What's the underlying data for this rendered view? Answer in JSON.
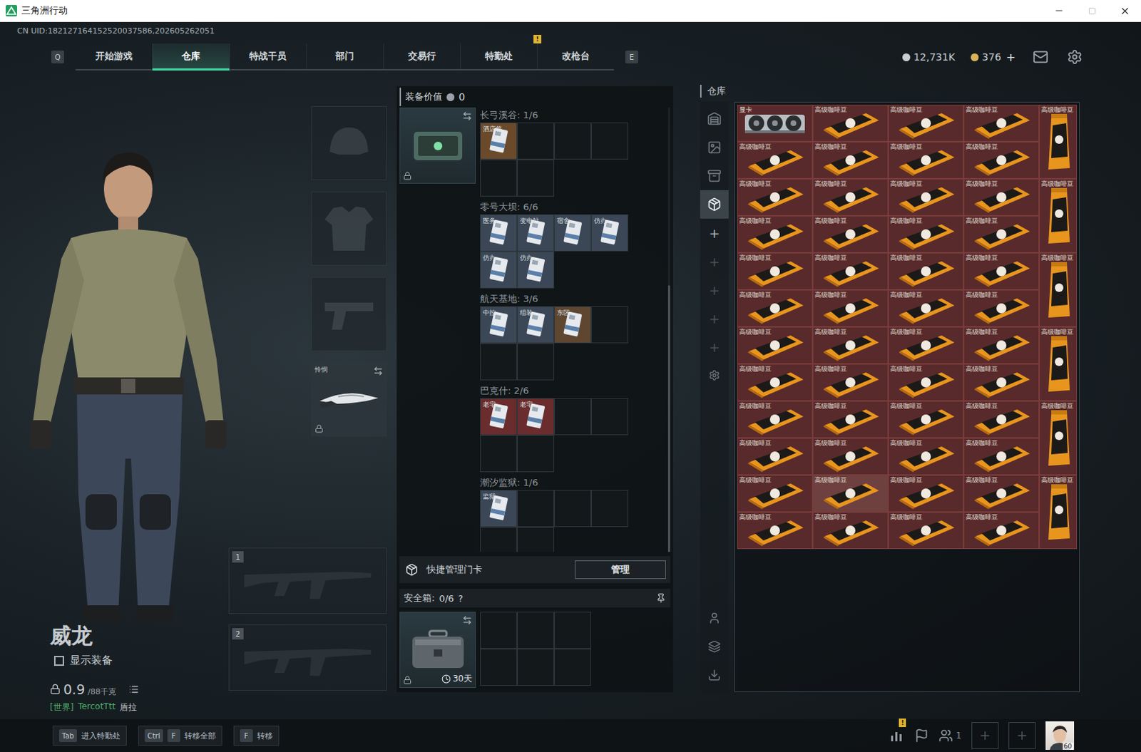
{
  "window": {
    "title": "三角洲行动"
  },
  "uid": "CN UID:182127164152520037586,202605262051",
  "nav": {
    "left_key": "Q",
    "right_key": "E",
    "tabs": [
      {
        "label": "开始游戏",
        "selected": false,
        "alert": ""
      },
      {
        "label": "仓库",
        "selected": true,
        "alert": ""
      },
      {
        "label": "特战干员",
        "selected": false,
        "alert": ""
      },
      {
        "label": "部门",
        "selected": false,
        "alert": ""
      },
      {
        "label": "交易行",
        "selected": false,
        "alert": ""
      },
      {
        "label": "特勤处",
        "selected": false,
        "alert": "!"
      },
      {
        "label": "改枪台",
        "selected": false,
        "alert": ""
      }
    ]
  },
  "currency": [
    {
      "value": "12,731K",
      "add": "",
      "color": "#c9ced3"
    },
    {
      "value": "376",
      "add": "+",
      "color": "#d8b25a"
    }
  ],
  "character": {
    "name": "威龙",
    "show_gear": {
      "label": "显示装备",
      "checked": false
    },
    "weight": {
      "value": "0.9",
      "max": "/88千克"
    },
    "chat": {
      "channel": "[世界]",
      "user": "TercotTtt",
      "message": "盾拉"
    }
  },
  "gear_slots": [
    {
      "kind": "helmet",
      "filled": false,
      "label": "",
      "locked": false
    },
    {
      "kind": "armor",
      "filled": false,
      "label": "",
      "locked": false
    },
    {
      "kind": "pistol",
      "filled": false,
      "label": "",
      "locked": false
    },
    {
      "kind": "melee",
      "filled": true,
      "label": "怜悯",
      "locked": true
    }
  ],
  "weapon_slots": [
    {
      "number": "1",
      "filled": false
    },
    {
      "number": "2",
      "filled": false
    }
  ],
  "loadout": {
    "title": "装备价值",
    "value": "0"
  },
  "keycards": {
    "case_locked": true,
    "slots_per_section": 6,
    "sections": [
      {
        "name": "长弓溪谷",
        "count": "1/6",
        "cards": [
          {
            "label": "酒店将",
            "color": "#6b4a2c"
          }
        ]
      },
      {
        "name": "零号大坝",
        "count": "6/6",
        "cards": [
          {
            "label": "医务",
            "color": "#3b4756"
          },
          {
            "label": "变电站",
            "color": "#3b4756"
          },
          {
            "label": "宿舍",
            "color": "#3b4756"
          },
          {
            "label": "仿办",
            "color": "#3b4756"
          },
          {
            "label": "仿办",
            "color": "#3b4756"
          },
          {
            "label": "仿办",
            "color": "#3b4756"
          }
        ]
      },
      {
        "name": "航天基地",
        "count": "3/6",
        "cards": [
          {
            "label": "中控",
            "color": "#3b4756"
          },
          {
            "label": "组装",
            "color": "#3b4756"
          },
          {
            "label": "东区",
            "color": "#5e4630"
          }
        ]
      },
      {
        "name": "巴克什",
        "count": "2/6",
        "cards": [
          {
            "label": "老宅",
            "color": "#6a2c2c"
          },
          {
            "label": "老宅",
            "color": "#6a2c2c"
          }
        ]
      },
      {
        "name": "潮汐监狱",
        "count": "1/6",
        "cards": [
          {
            "label": "监狱",
            "color": "#3b4756"
          }
        ]
      }
    ]
  },
  "quick_manage": {
    "label": "快捷管理门卡",
    "button": "管理"
  },
  "safe_box": {
    "label": "安全箱:",
    "count": "0/6",
    "help": "?",
    "duration": "30天",
    "slots": 6,
    "locked": true
  },
  "warehouse": {
    "title": "仓库",
    "sidebar_tabs": [
      {
        "selected": false
      },
      {
        "selected": false
      },
      {
        "selected": false
      },
      {
        "selected": true
      }
    ],
    "add_buttons": [
      "+",
      "+",
      "+",
      "+",
      "+"
    ],
    "items": [
      {
        "kind": "gpu",
        "label": "显卡",
        "hovered": false
      },
      {
        "kind": "wide",
        "label": "高级咖啡豆",
        "hovered": false
      },
      {
        "kind": "wide",
        "label": "高级咖啡豆",
        "hovered": false
      },
      {
        "kind": "wide",
        "label": "高级咖啡豆",
        "hovered": false
      },
      {
        "kind": "tall",
        "label": "高级咖啡豆",
        "hovered": false
      },
      {
        "kind": "wide",
        "label": "高级咖啡豆",
        "hovered": false
      },
      {
        "kind": "wide",
        "label": "高级咖啡豆",
        "hovered": false
      },
      {
        "kind": "wide",
        "label": "高级咖啡豆",
        "hovered": false
      },
      {
        "kind": "wide",
        "label": "高级咖啡豆",
        "hovered": false
      },
      {
        "kind": "wide",
        "label": "高级咖啡豆",
        "hovered": false
      },
      {
        "kind": "wide",
        "label": "高级咖啡豆",
        "hovered": false
      },
      {
        "kind": "wide",
        "label": "高级咖啡豆",
        "hovered": false
      },
      {
        "kind": "wide",
        "label": "高级咖啡豆",
        "hovered": false
      },
      {
        "kind": "tall",
        "label": "高级咖啡豆",
        "hovered": false
      },
      {
        "kind": "wide",
        "label": "高级咖啡豆",
        "hovered": false
      },
      {
        "kind": "wide",
        "label": "高级咖啡豆",
        "hovered": false
      },
      {
        "kind": "wide",
        "label": "高级咖啡豆",
        "hovered": false
      },
      {
        "kind": "wide",
        "label": "高级咖啡豆",
        "hovered": false
      },
      {
        "kind": "wide",
        "label": "高级咖啡豆",
        "hovered": false
      },
      {
        "kind": "wide",
        "label": "高级咖啡豆",
        "hovered": false
      },
      {
        "kind": "wide",
        "label": "高级咖啡豆",
        "hovered": false
      },
      {
        "kind": "wide",
        "label": "高级咖啡豆",
        "hovered": false
      },
      {
        "kind": "tall",
        "label": "高级咖啡豆",
        "hovered": false
      },
      {
        "kind": "wide",
        "label": "高级咖啡豆",
        "hovered": false
      },
      {
        "kind": "wide",
        "label": "高级咖啡豆",
        "hovered": false
      },
      {
        "kind": "wide",
        "label": "高级咖啡豆",
        "hovered": false
      },
      {
        "kind": "wide",
        "label": "高级咖啡豆",
        "hovered": false
      },
      {
        "kind": "wide",
        "label": "高级咖啡豆",
        "hovered": false
      },
      {
        "kind": "wide",
        "label": "高级咖啡豆",
        "hovered": false
      },
      {
        "kind": "wide",
        "label": "高级咖啡豆",
        "hovered": false
      },
      {
        "kind": "wide",
        "label": "高级咖啡豆",
        "hovered": false
      },
      {
        "kind": "tall",
        "label": "高级咖啡豆",
        "hovered": false
      },
      {
        "kind": "wide",
        "label": "高级咖啡豆",
        "hovered": false
      },
      {
        "kind": "wide",
        "label": "高级咖啡豆",
        "hovered": false
      },
      {
        "kind": "wide",
        "label": "高级咖啡豆",
        "hovered": false
      },
      {
        "kind": "wide",
        "label": "高级咖啡豆",
        "hovered": false
      },
      {
        "kind": "wide",
        "label": "高级咖啡豆",
        "hovered": false
      },
      {
        "kind": "wide",
        "label": "高级咖啡豆",
        "hovered": false
      },
      {
        "kind": "wide",
        "label": "高级咖啡豆",
        "hovered": false
      },
      {
        "kind": "wide",
        "label": "高级咖啡豆",
        "hovered": false
      },
      {
        "kind": "tall",
        "label": "高级咖啡豆",
        "hovered": false
      },
      {
        "kind": "wide",
        "label": "高级咖啡豆",
        "hovered": false
      },
      {
        "kind": "wide",
        "label": "高级咖啡豆",
        "hovered": false
      },
      {
        "kind": "wide",
        "label": "高级咖啡豆",
        "hovered": false
      },
      {
        "kind": "wide",
        "label": "高级咖啡豆",
        "hovered": false
      },
      {
        "kind": "wide",
        "label": "高级咖啡豆",
        "hovered": false
      },
      {
        "kind": "wide",
        "label": "高级咖啡豆",
        "hovered": true
      },
      {
        "kind": "wide",
        "label": "高级咖啡豆",
        "hovered": false
      },
      {
        "kind": "wide",
        "label": "高级咖啡豆",
        "hovered": false
      },
      {
        "kind": "tall",
        "label": "高级咖啡豆",
        "hovered": false
      },
      {
        "kind": "wide",
        "label": "高级咖啡豆",
        "hovered": false
      },
      {
        "kind": "wide",
        "label": "高级咖啡豆",
        "hovered": false
      },
      {
        "kind": "wide",
        "label": "高级咖啡豆",
        "hovered": false
      },
      {
        "kind": "wide",
        "label": "高级咖啡豆",
        "hovered": false
      }
    ]
  },
  "bottom_bar": {
    "hints": [
      {
        "keys": [
          "Tab"
        ],
        "label": "进入特勤处"
      },
      {
        "keys": [
          "Ctrl",
          "F"
        ],
        "label": "转移全部"
      },
      {
        "keys": [
          "F"
        ],
        "label": "转移"
      }
    ],
    "alert": "!",
    "friends": "1",
    "level": "60"
  }
}
